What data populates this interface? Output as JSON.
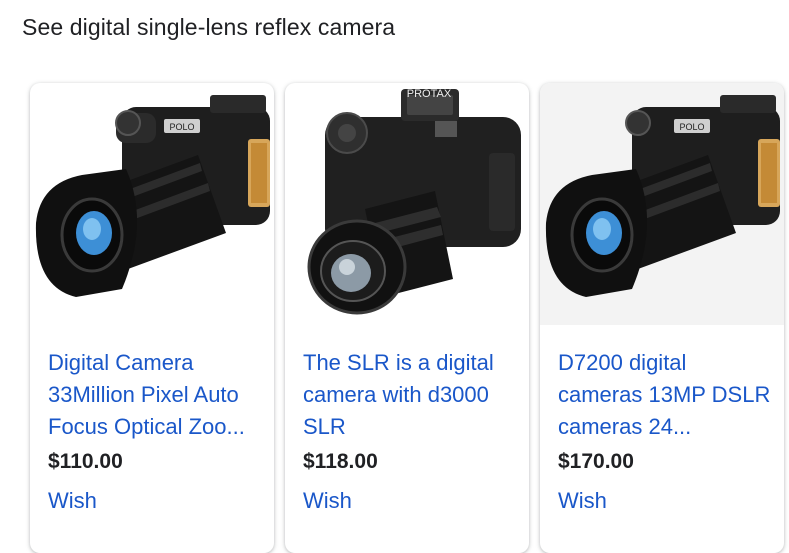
{
  "section": {
    "heading": "See digital single-lens reflex camera"
  },
  "products": [
    {
      "title": "Digital Camera 33Million Pixel Auto Focus Optical Zoo...",
      "price": "$110.00",
      "action": "Wish",
      "icon": "camera-lens-hood-icon",
      "brand_text": "POLO"
    },
    {
      "title": "The SLR is a digital camera with d3000 SLR",
      "price": "$118.00",
      "action": "Wish",
      "icon": "camera-zoom-lens-icon",
      "brand_text": "PROTAX"
    },
    {
      "title": "D7200 digital cameras 13MP DSLR cameras 24...",
      "price": "$170.00",
      "action": "Wish",
      "icon": "camera-lens-hood-icon",
      "brand_text": "POLO"
    }
  ],
  "colors": {
    "link": "#1a57c9",
    "text": "#202124"
  }
}
